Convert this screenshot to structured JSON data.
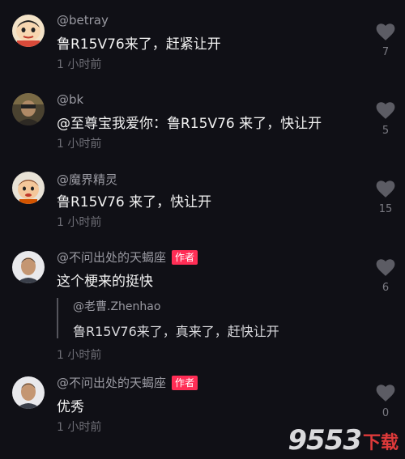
{
  "comments": [
    {
      "user": "@betray",
      "badge": "",
      "text": "鲁R15V76来了，赶紧让开",
      "time": "1 小时前",
      "likes": "7",
      "avatar": "cartoon-kid-icon"
    },
    {
      "user": "@bk",
      "badge": "",
      "text": "@至尊宝我爱你：鲁R15V76 来了，快让开",
      "time": "1 小时前",
      "likes": "5",
      "avatar": "photo-avatar"
    },
    {
      "user": "@魔界精灵",
      "badge": "",
      "text": "鲁R15V76 来了，快让开",
      "time": "1 小时前",
      "likes": "15",
      "avatar": "cartoon-character-icon"
    },
    {
      "user": "@不问出处的天蝎座",
      "badge": "作者",
      "text": "这个梗来的挺快",
      "time": "1 小时前",
      "likes": "6",
      "avatar": "person-photo",
      "quote": {
        "user": "@老曹.Zhenhao",
        "text": "鲁R15V76来了，真来了，赶快让开"
      }
    },
    {
      "user": "@不问出处的天蝎座",
      "badge": "作者",
      "text": "优秀",
      "time": "1 小时前",
      "likes": "0",
      "avatar": "person-photo"
    }
  ],
  "watermark": {
    "number": "9553",
    "label": "下载"
  },
  "colors": {
    "background": "#101016",
    "badge": "#ff2d55",
    "watermark_red": "#e03a3a"
  }
}
